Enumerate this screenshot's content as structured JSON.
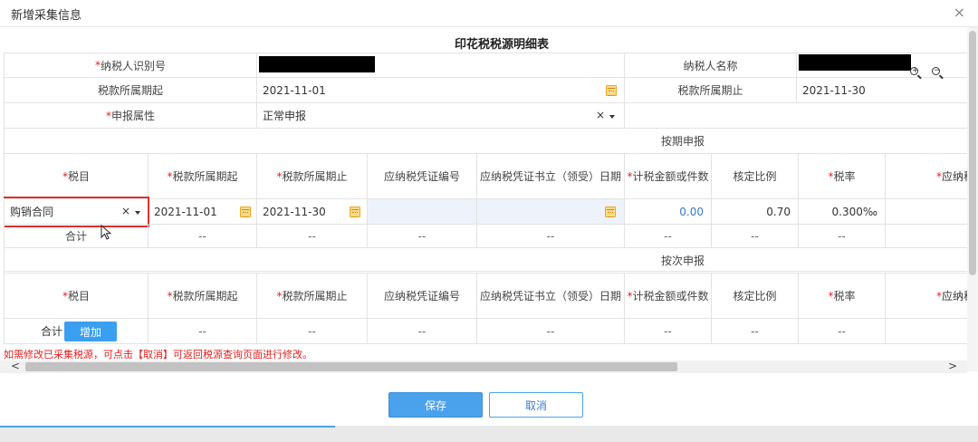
{
  "window": {
    "title": "新增采集信息",
    "close_glyph": "×"
  },
  "form": {
    "title": "印花税税源明细表",
    "taxpayer_id_label": "纳税人识别号",
    "taxpayer_name_label": "纳税人名称",
    "period_start_label": "税款所属期起",
    "period_start_value": "2021-11-01",
    "period_end_label": "税款所属期止",
    "period_end_value": "2021-11-30",
    "declare_attr_label": "申报属性",
    "declare_attr_value": "正常申报",
    "required_mark": "*"
  },
  "periodic": {
    "section_title": "按期申报",
    "headers": {
      "tax_item": "税目",
      "period_start": "税款所属期起",
      "period_end": "税款所属期止",
      "voucher_no": "应纳税凭证编号",
      "voucher_date": "应纳税凭证书立（领受）日期",
      "amount": "计税金额或件数",
      "ratio": "核定比例",
      "rate": "税率",
      "payable": "应纳税"
    },
    "row": {
      "tax_item": "购销合同",
      "period_start": "2021-11-01",
      "period_end": "2021-11-30",
      "amount": "0.00",
      "ratio": "0.70",
      "rate": "0.300‰"
    },
    "total_label": "合计",
    "empty": "--"
  },
  "per_time": {
    "section_title": "按次申报",
    "headers": {
      "tax_item": "税目",
      "period_start": "税款所属期起",
      "period_end": "税款所属期止",
      "voucher_no": "应纳税凭证编号",
      "voucher_date": "应纳税凭证书立（领受）日期",
      "amount": "计税金额或件数",
      "ratio": "核定比例",
      "rate": "税率",
      "payable": "应纳税"
    },
    "total_label": "合计",
    "add_label": "增加",
    "empty": "--"
  },
  "note": "如需修改已采集税源，可点击【取消】可返回税源查询页面进行修改。",
  "scroll": {
    "left_arrow": "<",
    "right_arrow": ">"
  },
  "buttons": {
    "save": "保存",
    "cancel": "取消"
  },
  "colors": {
    "primary": "#4aa2ec",
    "required": "#e02020",
    "highlight_box": "#e23030"
  },
  "icons": [
    "close-icon",
    "calendar-icon",
    "clear-icon",
    "caret-down-icon",
    "zoom-in-icon",
    "zoom-out-icon",
    "cursor-icon"
  ]
}
